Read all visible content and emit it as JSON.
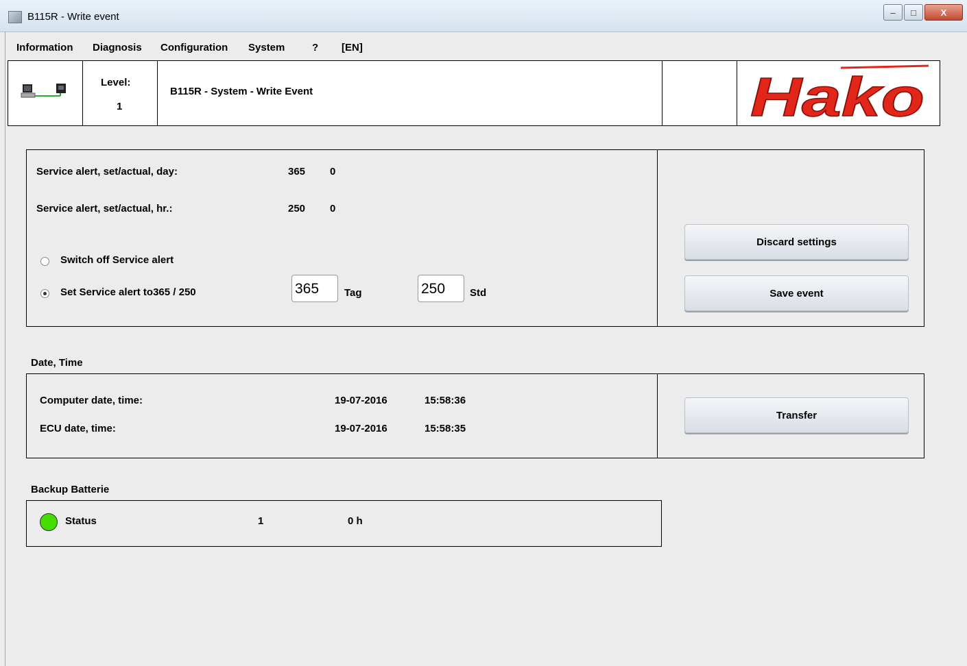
{
  "window": {
    "title": "B115R - Write event",
    "minimize": "–",
    "maximize": "□",
    "close": "X"
  },
  "menu": [
    "Information",
    "Diagnosis",
    "Configuration",
    "System",
    "?",
    "[EN]"
  ],
  "header": {
    "level_label": "Level:",
    "level_value": "1",
    "page_title": "B115R - System - Write Event",
    "logo_text": "Hako",
    "logo_color": "#e3261a"
  },
  "service": {
    "day_label": "Service alert, set/actual, day:",
    "day_set": "365",
    "day_actual": "0",
    "hr_label": "Service alert, set/actual, hr.:",
    "hr_set": "250",
    "hr_actual": "0",
    "option_off_label": "Switch off Service alert",
    "option_set_label": "Set Service alert to365 / 250",
    "selected_option": "set",
    "tag_value": "365",
    "tag_unit": "Tag",
    "std_value": "250",
    "std_unit": "Std",
    "discard_button": "Discard settings",
    "save_button": "Save event"
  },
  "datetime": {
    "section_title": "Date, Time",
    "computer_label": "Computer date, time:",
    "computer_date": "19-07-2016",
    "computer_time": "15:58:36",
    "ecu_label": "ECU date, time:",
    "ecu_date": "19-07-2016",
    "ecu_time": "15:58:35",
    "transfer_button": "Transfer"
  },
  "battery": {
    "section_title": "Backup Batterie",
    "status_label": "Status",
    "status_value": "1",
    "hours_value": "0 h",
    "status_color": "#44dd00"
  }
}
